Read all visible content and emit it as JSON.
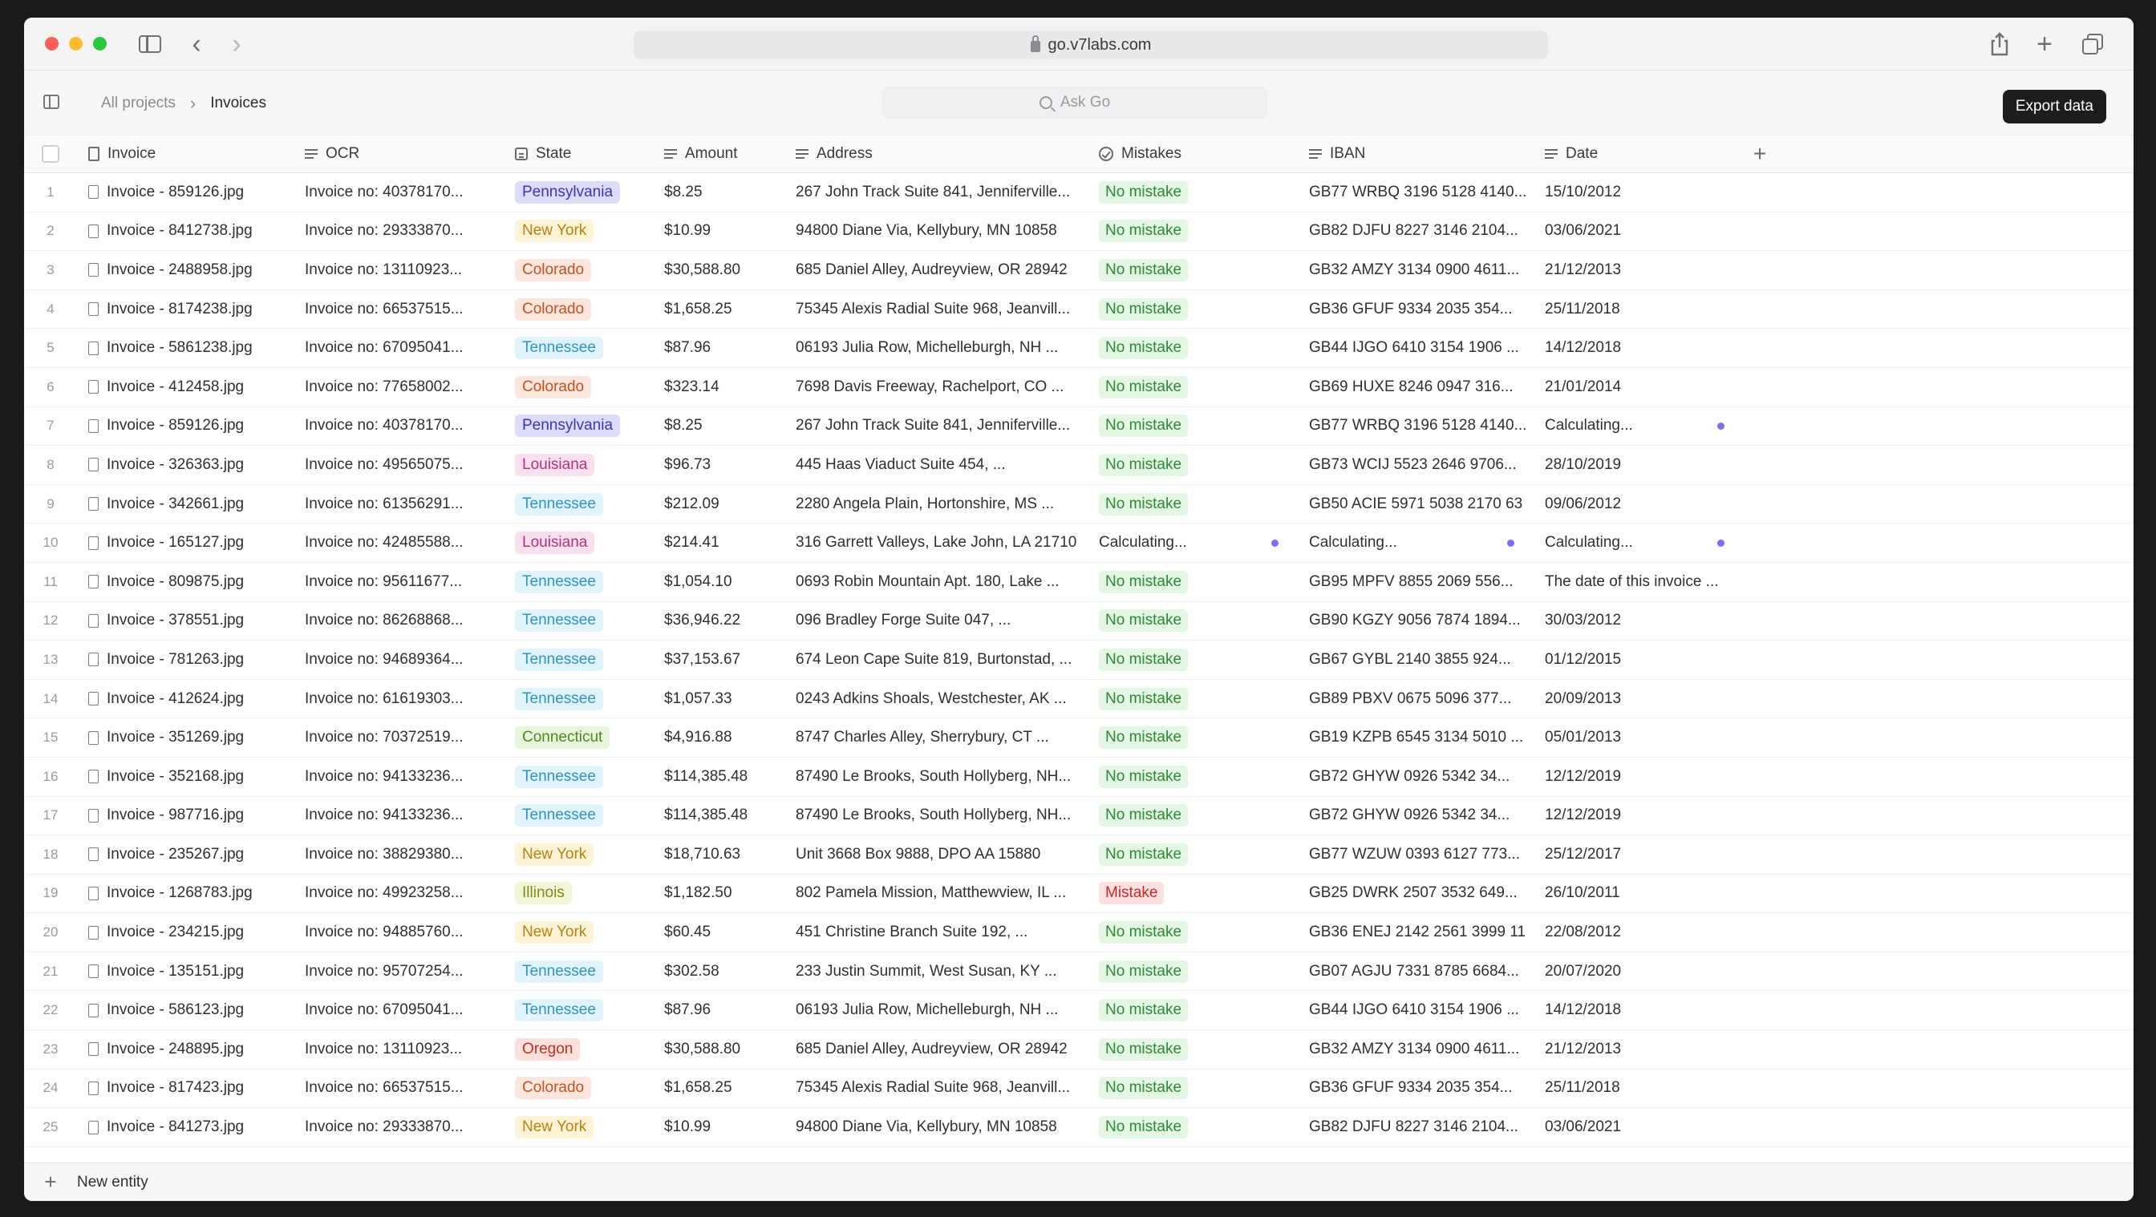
{
  "browser": {
    "url": "go.v7labs.com"
  },
  "app": {
    "breadcrumb": {
      "root": "All projects",
      "separator": "›",
      "current": "Invoices"
    },
    "search_placeholder": "Ask Go",
    "export_label": "Export data",
    "new_entity_label": "New entity"
  },
  "table": {
    "headers": {
      "invoice": "Invoice",
      "ocr": "OCR",
      "state": "State",
      "amount": "Amount",
      "address": "Address",
      "mistakes": "Mistakes",
      "iban": "IBAN",
      "date": "Date"
    },
    "rows": [
      {
        "idx": "1",
        "invoice": "Invoice - 859126.jpg",
        "ocr": "Invoice no: 40378170...",
        "state": "Pennsylvania",
        "amount": "$8.25",
        "address": "267 John Track Suite 841, Jenniferville...",
        "mistakes": "No mistake",
        "iban": "GB77 WRBQ 3196 5128 4140...",
        "date": "15/10/2012"
      },
      {
        "idx": "2",
        "invoice": "Invoice - 8412738.jpg",
        "ocr": "Invoice no: 29333870...",
        "state": "New York",
        "amount": "$10.99",
        "address": "94800 Diane Via, Kellybury, MN 10858",
        "mistakes": "No mistake",
        "iban": "GB82 DJFU 8227 3146 2104...",
        "date": "03/06/2021"
      },
      {
        "idx": "3",
        "invoice": "Invoice - 2488958.jpg",
        "ocr": "Invoice no: 13110923...",
        "state": "Colorado",
        "amount": "$30,588.80",
        "address": "685 Daniel Alley, Audreyview, OR 28942",
        "mistakes": "No mistake",
        "iban": "GB32 AMZY 3134 0900 4611...",
        "date": "21/12/2013"
      },
      {
        "idx": "4",
        "invoice": "Invoice - 8174238.jpg",
        "ocr": "Invoice no: 66537515...",
        "state": "Colorado",
        "amount": "$1,658.25",
        "address": "75345 Alexis Radial Suite 968, Jeanvill...",
        "mistakes": "No mistake",
        "iban": "GB36 GFUF 9334 2035 354...",
        "date": "25/11/2018"
      },
      {
        "idx": "5",
        "invoice": "Invoice - 5861238.jpg",
        "ocr": "Invoice no: 67095041...",
        "state": "Tennessee",
        "amount": "$87.96",
        "address": "06193 Julia Row, Michelleburgh, NH ...",
        "mistakes": "No mistake",
        "iban": "GB44 IJGO 6410 3154 1906 ...",
        "date": "14/12/2018"
      },
      {
        "idx": "6",
        "invoice": "Invoice - 412458.jpg",
        "ocr": "Invoice no: 77658002...",
        "state": "Colorado",
        "amount": "$323.14",
        "address": "7698 Davis Freeway, Rachelport, CO ...",
        "mistakes": "No mistake",
        "iban": "GB69 HUXE 8246 0947 316...",
        "date": "21/01/2014"
      },
      {
        "idx": "7",
        "invoice": "Invoice - 859126.jpg",
        "ocr": "Invoice no: 40378170...",
        "state": "Pennsylvania",
        "amount": "$8.25",
        "address": "267 John Track Suite 841, Jenniferville...",
        "mistakes": "No mistake",
        "iban": "GB77 WRBQ 3196 5128 4140...",
        "date": "Calculating..."
      },
      {
        "idx": "8",
        "invoice": "Invoice - 326363.jpg",
        "ocr": "Invoice no: 49565075...",
        "state": "Louisiana",
        "amount": "$96.73",
        "address": "445 Haas Viaduct Suite 454, ...",
        "mistakes": "No mistake",
        "iban": "GB73 WCIJ 5523 2646 9706...",
        "date": "28/10/2019"
      },
      {
        "idx": "9",
        "invoice": "Invoice - 342661.jpg",
        "ocr": "Invoice no: 61356291...",
        "state": "Tennessee",
        "amount": "$212.09",
        "address": "2280 Angela Plain, Hortonshire, MS ...",
        "mistakes": "No mistake",
        "iban": "GB50 ACIE 5971 5038 2170 63",
        "date": "09/06/2012"
      },
      {
        "idx": "10",
        "invoice": "Invoice - 165127.jpg",
        "ocr": "Invoice no: 42485588...",
        "state": "Louisiana",
        "amount": "$214.41",
        "address": "316 Garrett Valleys, Lake John, LA 21710",
        "mistakes": "Calculating...",
        "iban": "Calculating...",
        "date": "Calculating..."
      },
      {
        "idx": "11",
        "invoice": "Invoice - 809875.jpg",
        "ocr": "Invoice no: 95611677...",
        "state": "Tennessee",
        "amount": "$1,054.10",
        "address": "0693 Robin Mountain Apt. 180, Lake ...",
        "mistakes": "No mistake",
        "iban": "GB95 MPFV 8855 2069 556...",
        "date": "The date of this invoice ..."
      },
      {
        "idx": "12",
        "invoice": "Invoice - 378551.jpg",
        "ocr": "Invoice no: 86268868...",
        "state": "Tennessee",
        "amount": "$36,946.22",
        "address": "096 Bradley Forge Suite 047, ...",
        "mistakes": "No mistake",
        "iban": "GB90 KGZY 9056 7874 1894...",
        "date": "30/03/2012"
      },
      {
        "idx": "13",
        "invoice": "Invoice - 781263.jpg",
        "ocr": "Invoice no: 94689364...",
        "state": "Tennessee",
        "amount": "$37,153.67",
        "address": "674 Leon Cape Suite 819, Burtonstad, ...",
        "mistakes": "No mistake",
        "iban": "GB67 GYBL 2140 3855 924...",
        "date": "01/12/2015"
      },
      {
        "idx": "14",
        "invoice": "Invoice - 412624.jpg",
        "ocr": "Invoice no: 61619303...",
        "state": "Tennessee",
        "amount": "$1,057.33",
        "address": "0243 Adkins Shoals, Westchester, AK ...",
        "mistakes": "No mistake",
        "iban": "GB89 PBXV 0675 5096 377...",
        "date": "20/09/2013"
      },
      {
        "idx": "15",
        "invoice": "Invoice - 351269.jpg",
        "ocr": "Invoice no: 70372519...",
        "state": "Connecticut",
        "amount": "$4,916.88",
        "address": "8747 Charles Alley, Sherrybury, CT ...",
        "mistakes": "No mistake",
        "iban": "GB19 KZPB 6545 3134 5010 ...",
        "date": "05/01/2013"
      },
      {
        "idx": "16",
        "invoice": "Invoice - 352168.jpg",
        "ocr": "Invoice no: 94133236...",
        "state": "Tennessee",
        "amount": "$114,385.48",
        "address": "87490 Le Brooks, South Hollyberg, NH...",
        "mistakes": "No mistake",
        "iban": "GB72 GHYW 0926 5342 34...",
        "date": "12/12/2019"
      },
      {
        "idx": "17",
        "invoice": "Invoice - 987716.jpg",
        "ocr": "Invoice no: 94133236...",
        "state": "Tennessee",
        "amount": "$114,385.48",
        "address": "87490 Le Brooks, South Hollyberg, NH...",
        "mistakes": "No mistake",
        "iban": "GB72 GHYW 0926 5342 34...",
        "date": "12/12/2019"
      },
      {
        "idx": "18",
        "invoice": "Invoice - 235267.jpg",
        "ocr": "Invoice no: 38829380...",
        "state": "New York",
        "amount": "$18,710.63",
        "address": "Unit 3668 Box 9888, DPO AA 15880",
        "mistakes": "No mistake",
        "iban": "GB77 WZUW 0393 6127 773...",
        "date": "25/12/2017"
      },
      {
        "idx": "19",
        "invoice": "Invoice - 1268783.jpg",
        "ocr": "Invoice no: 49923258...",
        "state": "Illinois",
        "amount": "$1,182.50",
        "address": "802 Pamela Mission, Matthewview, IL ...",
        "mistakes": "Mistake",
        "iban": "GB25 DWRK 2507 3532 649...",
        "date": "26/10/2011"
      },
      {
        "idx": "20",
        "invoice": "Invoice - 234215.jpg",
        "ocr": "Invoice no: 94885760...",
        "state": "New York",
        "amount": "$60.45",
        "address": "451 Christine Branch Suite 192, ...",
        "mistakes": "No mistake",
        "iban": "GB36 ENEJ 2142 2561 3999 11",
        "date": "22/08/2012"
      },
      {
        "idx": "21",
        "invoice": "Invoice - 135151.jpg",
        "ocr": "Invoice no: 95707254...",
        "state": "Tennessee",
        "amount": "$302.58",
        "address": "233 Justin Summit, West Susan, KY ...",
        "mistakes": "No mistake",
        "iban": "GB07 AGJU 7331 8785 6684...",
        "date": "20/07/2020"
      },
      {
        "idx": "22",
        "invoice": "Invoice - 586123.jpg",
        "ocr": "Invoice no: 67095041...",
        "state": "Tennessee",
        "amount": "$87.96",
        "address": "06193 Julia Row, Michelleburgh, NH ...",
        "mistakes": "No mistake",
        "iban": "GB44 IJGO 6410 3154 1906 ...",
        "date": "14/12/2018"
      },
      {
        "idx": "23",
        "invoice": "Invoice - 248895.jpg",
        "ocr": "Invoice no: 13110923...",
        "state": "Oregon",
        "amount": "$30,588.80",
        "address": "685 Daniel Alley, Audreyview, OR 28942",
        "mistakes": "No mistake",
        "iban": "GB32 AMZY 3134 0900 4611...",
        "date": "21/12/2013"
      },
      {
        "idx": "24",
        "invoice": "Invoice - 817423.jpg",
        "ocr": "Invoice no: 66537515...",
        "state": "Colorado",
        "amount": "$1,658.25",
        "address": "75345 Alexis Radial Suite 968, Jeanvill...",
        "mistakes": "No mistake",
        "iban": "GB36 GFUF 9334 2035 354...",
        "date": "25/11/2018"
      },
      {
        "idx": "25",
        "invoice": "Invoice - 841273.jpg",
        "ocr": "Invoice no: 29333870...",
        "state": "New York",
        "amount": "$10.99",
        "address": "94800 Diane Via, Kellybury, MN 10858",
        "mistakes": "No mistake",
        "iban": "GB82 DJFU 8227 3146 2104...",
        "date": "03/06/2021"
      }
    ]
  },
  "state_colors": {
    "Pennsylvania": {
      "bg": "#dcdcfb",
      "fg": "#3b35b8"
    },
    "New York": {
      "bg": "#fdf3d7",
      "fg": "#b9810e"
    },
    "Colorado": {
      "bg": "#fde6dd",
      "fg": "#c2521f"
    },
    "Tennessee": {
      "bg": "#e1f3fb",
      "fg": "#2f95c4"
    },
    "Louisiana": {
      "bg": "#f8e0ef",
      "fg": "#b4327a"
    },
    "Connecticut": {
      "bg": "#e8f5dc",
      "fg": "#4a8a20"
    },
    "Illinois": {
      "bg": "#f3f7d8",
      "fg": "#7d8a12"
    },
    "Oregon": {
      "bg": "#fde0dc",
      "fg": "#c0321f"
    }
  },
  "mistake_colors": {
    "No mistake": {
      "bg": "#e4f7e4",
      "fg": "#2d8a34"
    },
    "Mistake": {
      "bg": "#fde0e0",
      "fg": "#c62828"
    }
  },
  "icons": {
    "calculating": "calculating-dot-icon",
    "accent": "#7b6ef6"
  }
}
